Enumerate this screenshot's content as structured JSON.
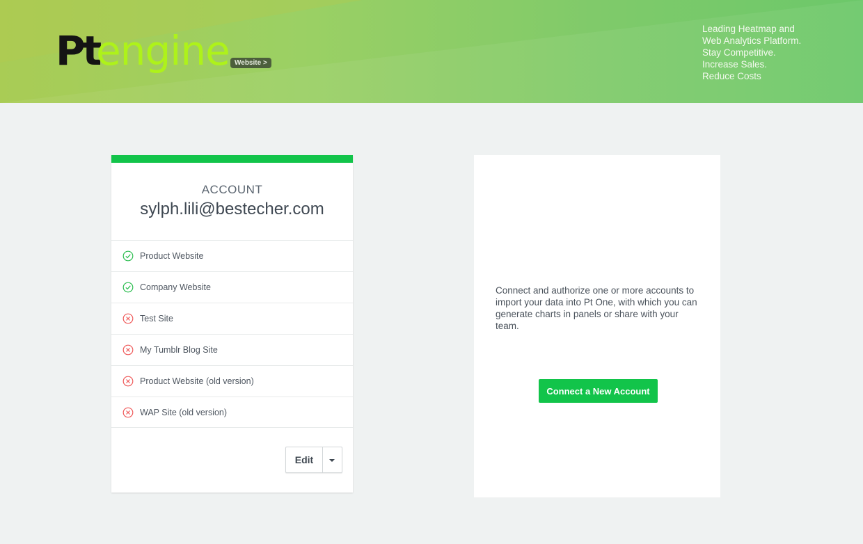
{
  "header": {
    "logo": {
      "pt": "Pt",
      "engine": "engine"
    },
    "badge_label": "Website >",
    "tagline": [
      "Leading Heatmap and",
      "Web Analytics Platform.",
      "Stay Competitive.",
      "Increase Sales.",
      "Reduce Costs"
    ]
  },
  "account": {
    "label": "ACCOUNT",
    "email": "sylph.lili@bestecher.com",
    "sites": [
      {
        "name": "Product Website",
        "status": "ok"
      },
      {
        "name": "Company Website",
        "status": "ok"
      },
      {
        "name": "Test Site",
        "status": "error"
      },
      {
        "name": "My Tumblr Blog Site",
        "status": "error"
      },
      {
        "name": "Product Website (old version)",
        "status": "error"
      },
      {
        "name": "WAP Site (old version)",
        "status": "error"
      }
    ],
    "edit_label": "Edit"
  },
  "connect": {
    "description": "Connect and authorize one or more accounts to import your data into Pt One, with which you can generate charts in panels or share with your team.",
    "button_label": "Connect a New Account"
  },
  "colors": {
    "accent_green": "#12c44a",
    "ok_icon": "#2bbd4f",
    "error_icon": "#ef5a5a"
  }
}
